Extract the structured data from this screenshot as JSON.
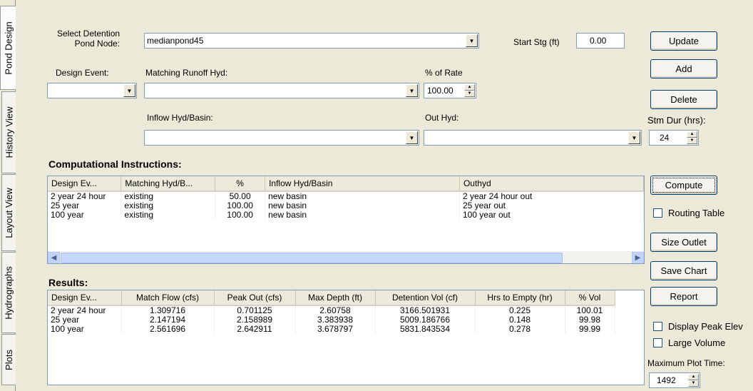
{
  "tabs": [
    "Pond Design",
    "History View",
    "Layout View",
    "Hydrographs",
    "Plots"
  ],
  "form": {
    "select_label_1": "Select Detention",
    "select_label_2": "Pond Node:",
    "pond_node": "medianpond45",
    "start_stg_label": "Start Stg (ft)",
    "start_stg": "0.00",
    "design_event_label": "Design Event:",
    "design_event": "",
    "matching_runoff_label": "Matching Runoff Hyd:",
    "matching_runoff": "",
    "rate_label": "% of Rate",
    "rate": "100.00",
    "inflow_label": "Inflow Hyd/Basin:",
    "inflow": "",
    "out_hyd_label": "Out Hyd:",
    "out_hyd": "",
    "stm_dur_label": "Stm Dur (hrs):",
    "stm_dur": "24"
  },
  "buttons": {
    "update": "Update",
    "add": "Add",
    "delete": "Delete",
    "compute": "Compute",
    "size_outlet": "Size Outlet",
    "save_chart": "Save Chart",
    "report": "Report"
  },
  "checks": {
    "routing_table": "Routing Table",
    "display_peak": "Display Peak Elev",
    "large_volume": "Large Volume"
  },
  "max_plot": {
    "label": "Maximum Plot Time:",
    "value": "1492"
  },
  "instructions": {
    "title": "Computational Instructions:",
    "columns": [
      "Design Ev...",
      "Matching Hyd/B...",
      "%",
      "Inflow Hyd/Basin",
      "Outhyd"
    ],
    "rows": [
      [
        "2 year 24 hour",
        "existing",
        "50.00",
        "new basin",
        "2 year 24 hour out"
      ],
      [
        "25 year",
        "existing",
        "100.00",
        "new basin",
        "25 year out"
      ],
      [
        "100 year",
        "existing",
        "100.00",
        "new basin",
        "100 year out"
      ]
    ]
  },
  "results": {
    "title": "Results:",
    "columns": [
      "Design Ev...",
      "Match Flow (cfs)",
      "Peak Out (cfs)",
      "Max Depth (ft)",
      "Detention Vol (cf)",
      "Hrs to Empty (hr)",
      "% Vol"
    ],
    "rows": [
      [
        "2 year 24 hour",
        "1.309716",
        "0.701125",
        "2.60758",
        "3166.501931",
        "0.225",
        "100.01"
      ],
      [
        "25 year",
        "2.147194",
        "2.158989",
        "3.383938",
        "5009.186766",
        "0.148",
        "99.98"
      ],
      [
        "100 year",
        "2.561696",
        "2.642911",
        "3.678797",
        "5831.843534",
        "0.278",
        "99.99"
      ]
    ]
  }
}
